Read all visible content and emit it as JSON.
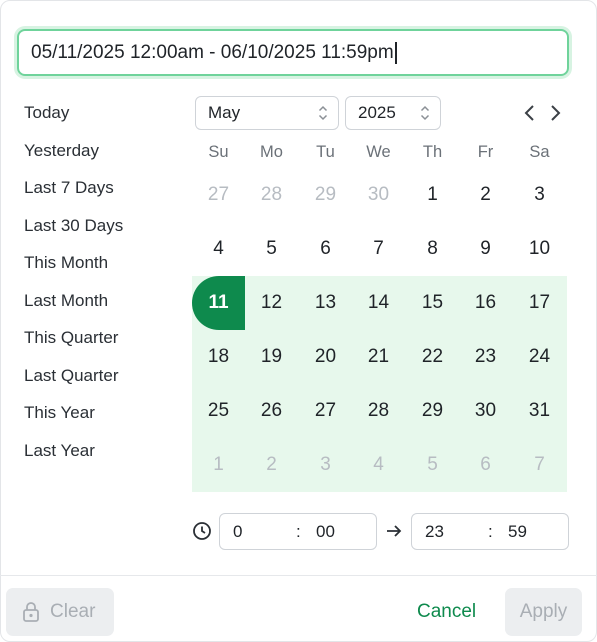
{
  "range_input": {
    "value": "05/11/2025 12:00am - 06/10/2025 11:59pm"
  },
  "presets": [
    "Today",
    "Yesterday",
    "Last 7 Days",
    "Last 30 Days",
    "This Month",
    "Last Month",
    "This Quarter",
    "Last Quarter",
    "This Year",
    "Last Year"
  ],
  "calendar": {
    "month": "May",
    "year": "2025",
    "weekdays": [
      "Su",
      "Mo",
      "Tu",
      "We",
      "Th",
      "Fr",
      "Sa"
    ],
    "weeks": [
      [
        {
          "d": "27",
          "muted": true
        },
        {
          "d": "28",
          "muted": true
        },
        {
          "d": "29",
          "muted": true
        },
        {
          "d": "30",
          "muted": true
        },
        {
          "d": "1"
        },
        {
          "d": "2"
        },
        {
          "d": "3"
        }
      ],
      [
        {
          "d": "4"
        },
        {
          "d": "5"
        },
        {
          "d": "6"
        },
        {
          "d": "7"
        },
        {
          "d": "8"
        },
        {
          "d": "9"
        },
        {
          "d": "10"
        }
      ],
      [
        {
          "d": "11",
          "selected": true
        },
        {
          "d": "12"
        },
        {
          "d": "13"
        },
        {
          "d": "14"
        },
        {
          "d": "15"
        },
        {
          "d": "16"
        },
        {
          "d": "17"
        }
      ],
      [
        {
          "d": "18"
        },
        {
          "d": "19"
        },
        {
          "d": "20"
        },
        {
          "d": "21"
        },
        {
          "d": "22"
        },
        {
          "d": "23"
        },
        {
          "d": "24"
        }
      ],
      [
        {
          "d": "25"
        },
        {
          "d": "26"
        },
        {
          "d": "27"
        },
        {
          "d": "28"
        },
        {
          "d": "29"
        },
        {
          "d": "30"
        },
        {
          "d": "31"
        }
      ],
      [
        {
          "d": "1",
          "muted": true
        },
        {
          "d": "2",
          "muted": true
        },
        {
          "d": "3",
          "muted": true
        },
        {
          "d": "4",
          "muted": true
        },
        {
          "d": "5",
          "muted": true
        },
        {
          "d": "6",
          "muted": true
        },
        {
          "d": "7",
          "muted": true
        }
      ]
    ]
  },
  "time": {
    "start_hour": "0",
    "start_minute": "00",
    "end_hour": "23",
    "end_minute": "59",
    "separator": ":"
  },
  "footer": {
    "clear": "Clear",
    "cancel": "Cancel",
    "apply": "Apply"
  },
  "colors": {
    "accent": "#0e8a4d",
    "range_fill": "#e7f8ec",
    "focus_border": "#6fd39b"
  },
  "icons": {
    "clock": "clock-icon",
    "arrow": "arrow-right-icon",
    "lock": "lock-icon"
  }
}
